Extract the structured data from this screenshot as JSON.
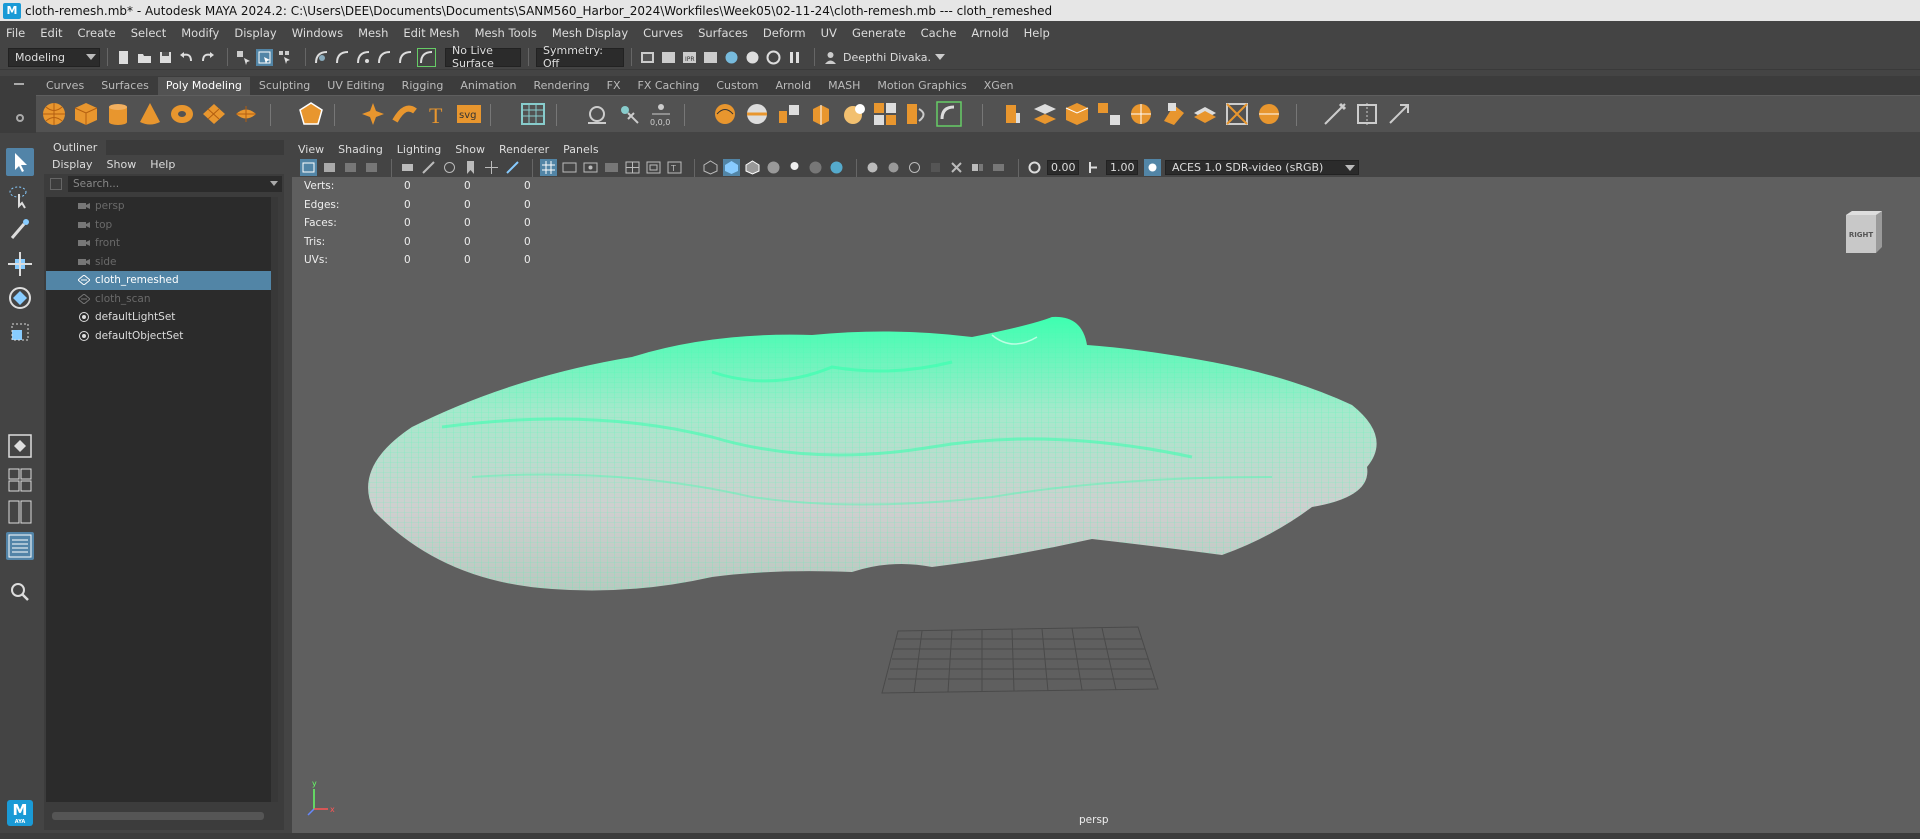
{
  "titlebar": {
    "text": "cloth-remesh.mb* - Autodesk MAYA 2024.2: C:\\Users\\DEE\\Documents\\Documents\\SANM560_Harbor_2024\\Workfiles\\Week05\\02-11-24\\cloth-remesh.mb   ---   cloth_remeshed",
    "logo": "M"
  },
  "menubar": [
    "File",
    "Edit",
    "Create",
    "Select",
    "Modify",
    "Display",
    "Windows",
    "Mesh",
    "Edit Mesh",
    "Mesh Tools",
    "Mesh Display",
    "Curves",
    "Surfaces",
    "Deform",
    "UV",
    "Generate",
    "Cache",
    "Arnold",
    "Help"
  ],
  "statusline": {
    "mode": "Modeling",
    "live_surface": "No Live Surface",
    "symmetry": "Symmetry: Off",
    "user": "Deepthi Divaka."
  },
  "shelf_tabs": [
    "Curves",
    "Surfaces",
    "Poly Modeling",
    "Sculpting",
    "UV Editing",
    "Rigging",
    "Animation",
    "Rendering",
    "FX",
    "FX Caching",
    "Custom",
    "Arnold",
    "MASH",
    "Motion Graphics",
    "XGen"
  ],
  "shelf_active": "Poly Modeling",
  "shelf_icons": {
    "text_tool": "T",
    "svg_tool": "svg",
    "xyz_readout": "0,0,0"
  },
  "outliner": {
    "tab": "Outliner",
    "menu": [
      "Display",
      "Show",
      "Help"
    ],
    "search_placeholder": "Search...",
    "items": [
      {
        "label": "persp",
        "icon": "camera-icon",
        "dim": true
      },
      {
        "label": "top",
        "icon": "camera-icon",
        "dim": true
      },
      {
        "label": "front",
        "icon": "camera-icon",
        "dim": true
      },
      {
        "label": "side",
        "icon": "camera-icon",
        "dim": true
      },
      {
        "label": "cloth_remeshed",
        "icon": "mesh-icon",
        "selected": true
      },
      {
        "label": "cloth_scan",
        "icon": "mesh-icon",
        "dim": true
      },
      {
        "label": "defaultLightSet",
        "icon": "set-icon"
      },
      {
        "label": "defaultObjectSet",
        "icon": "set-icon"
      }
    ]
  },
  "viewport": {
    "menu": [
      "View",
      "Shading",
      "Lighting",
      "Show",
      "Renderer",
      "Panels"
    ],
    "field1": "0.00",
    "field2": "1.00",
    "color_space": "ACES 1.0 SDR-video (sRGB)",
    "hud": [
      {
        "label": "Verts:",
        "a": "0",
        "b": "0",
        "c": "0"
      },
      {
        "label": "Edges:",
        "a": "0",
        "b": "0",
        "c": "0"
      },
      {
        "label": "Faces:",
        "a": "0",
        "b": "0",
        "c": "0"
      },
      {
        "label": "Tris:",
        "a": "0",
        "b": "0",
        "c": "0"
      },
      {
        "label": "UVs:",
        "a": "0",
        "b": "0",
        "c": "0"
      }
    ],
    "viewcube_label": "RIGHT",
    "camera_label": "persp",
    "axis_y": "y",
    "axis_x": "x",
    "mesh_wire_color": "#3dffb0",
    "mesh_fill_color": "#c9c9c9"
  },
  "colors": {
    "selection": "#5285a6",
    "accent": "#1a9ad6"
  },
  "toolbox_logo": "M",
  "toolbox_logo_sub": "AYA"
}
